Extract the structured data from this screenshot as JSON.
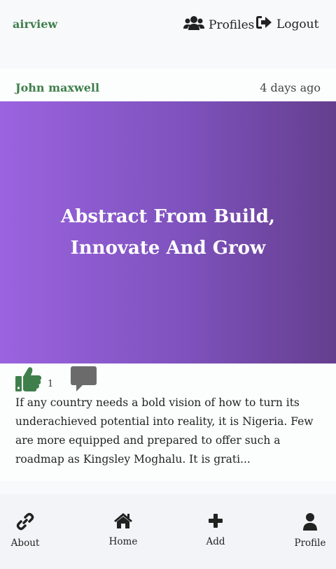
{
  "header": {
    "brand": "airview",
    "nav": {
      "profiles_label": "Profiles",
      "logout_label": "Logout"
    }
  },
  "post": {
    "author": "John maxwell",
    "time_ago": "4 days ago",
    "banner_title": "Abstract From Build, Innovate And Grow",
    "likes": "1",
    "excerpt": "If any country needs a bold vision of how to turn its underachieved potential into reality, it is Nigeria. Few are more equipped and prepared to offer such a roadmap as Kingsley Moghalu. It is grati..."
  },
  "bottom_nav": {
    "items": [
      {
        "label": "About",
        "icon": "link-icon"
      },
      {
        "label": "Home",
        "icon": "home-icon"
      },
      {
        "label": "Add",
        "icon": "plus-icon"
      },
      {
        "label": "Profile",
        "icon": "user-icon"
      }
    ]
  },
  "colors": {
    "brand": "#3f7f4b",
    "like": "#3f7f4b",
    "comment": "#6b6b6b",
    "banner_start": "#9b63df",
    "banner_end": "#643f8e"
  }
}
